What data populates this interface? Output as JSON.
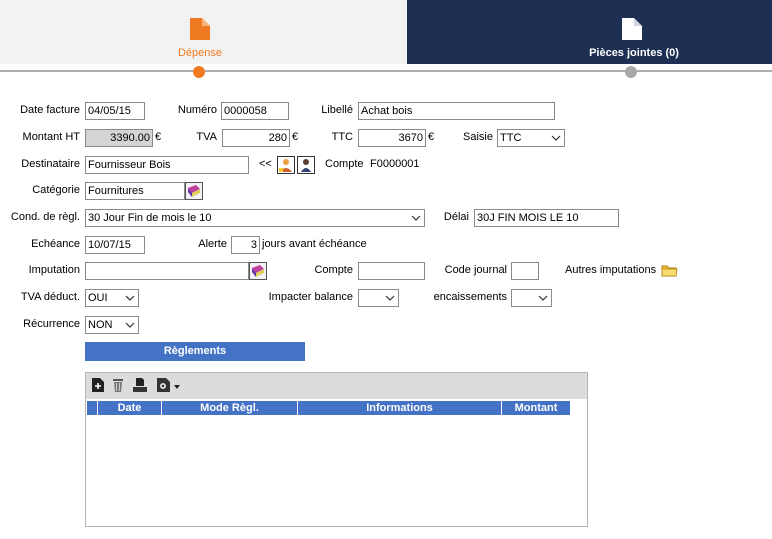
{
  "steps": {
    "step1_label": "Dépense",
    "step2_label": "Pièces jointes (0)"
  },
  "colors": {
    "accent": "#f07a22",
    "navy": "#1e2f54",
    "blue": "#4472c4"
  },
  "form": {
    "date_facture": {
      "label": "Date facture",
      "value": "04/05/15"
    },
    "numero": {
      "label": "Numéro",
      "value": "0000058"
    },
    "libelle": {
      "label": "Libellé",
      "value": "Achat bois"
    },
    "montant_ht": {
      "label": "Montant HT",
      "value": "3390.00",
      "unit": "€"
    },
    "tva": {
      "label": "TVA",
      "value": "280",
      "unit": "€"
    },
    "ttc": {
      "label": "TTC",
      "value": "3670",
      "unit": "€"
    },
    "saisie": {
      "label": "Saisie",
      "value": "TTC"
    },
    "destinataire": {
      "label": "Destinataire",
      "value": "Fournisseur Bois",
      "arrows": "<<"
    },
    "compte_dest": {
      "label": "Compte",
      "value": "F0000001"
    },
    "categorie": {
      "label": "Catégorie",
      "value": "Fournitures"
    },
    "cond_regl": {
      "label": "Cond. de règl.",
      "value": "30 Jour Fin de mois le 10"
    },
    "delai": {
      "label": "Délai",
      "value": "30J FIN MOIS LE 10"
    },
    "echeance": {
      "label": "Echéance",
      "value": "10/07/15"
    },
    "alerte": {
      "label": "Alerte",
      "value": "3",
      "suffix": "jours avant échéance"
    },
    "imputation": {
      "label": "Imputation",
      "value": ""
    },
    "compte": {
      "label": "Compte",
      "value": ""
    },
    "code_journal": {
      "label": "Code journal",
      "value": ""
    },
    "autres_imputations": {
      "label": "Autres imputations"
    },
    "tva_deduct": {
      "label": "TVA déduct.",
      "value": "OUI"
    },
    "impacter_balance": {
      "label": "Impacter balance",
      "value": ""
    },
    "encaissements": {
      "label": "encaissements",
      "value": ""
    },
    "recurrence": {
      "label": "Récurrence",
      "value": "NON"
    }
  },
  "reglements": {
    "title": "Règlements",
    "toolbar_icons": [
      "add-icon",
      "trash-icon",
      "stamp-icon",
      "settings-icon"
    ],
    "columns": [
      "Date",
      "Mode Règl.",
      "Informations",
      "Montant"
    ],
    "rows": []
  }
}
